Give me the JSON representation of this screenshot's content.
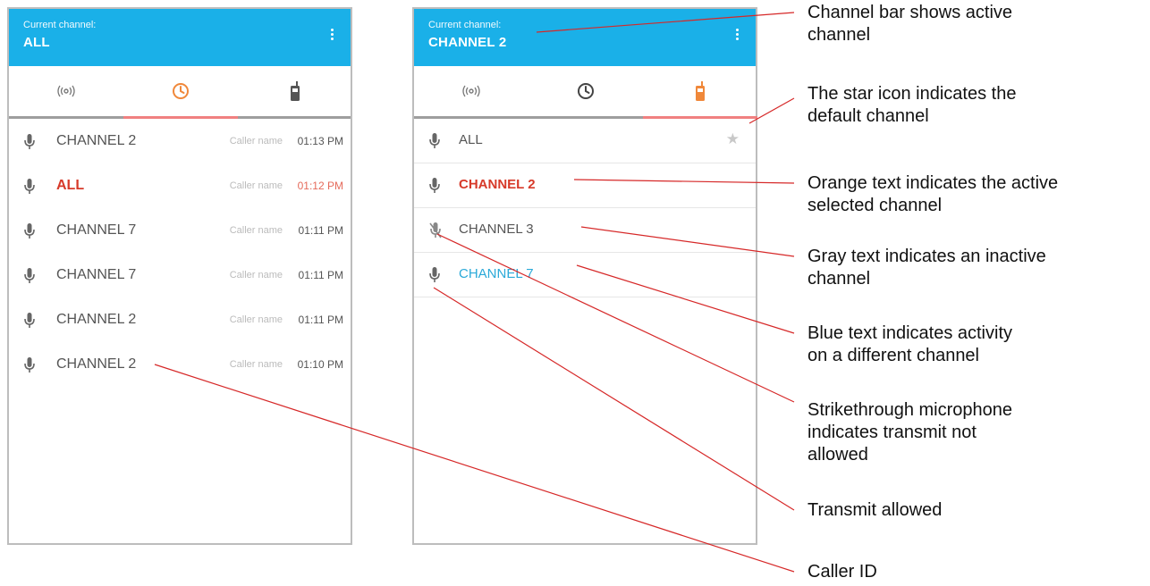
{
  "left_screen": {
    "header": {
      "caption": "Current channel:",
      "channel": "ALL"
    },
    "history": [
      {
        "channel": "CHANNEL 2",
        "caller": "Caller name",
        "time": "01:13 PM"
      },
      {
        "channel": "ALL",
        "caller": "Caller name",
        "time": "01:12 PM"
      },
      {
        "channel": "CHANNEL 7",
        "caller": "Caller name",
        "time": "01:11 PM"
      },
      {
        "channel": "CHANNEL 7",
        "caller": "Caller name",
        "time": "01:11 PM"
      },
      {
        "channel": "CHANNEL 2",
        "caller": "Caller name",
        "time": "01:11 PM"
      },
      {
        "channel": "CHANNEL 2",
        "caller": "Caller name",
        "time": "01:10 PM"
      }
    ]
  },
  "right_screen": {
    "header": {
      "caption": "Current channel:",
      "channel": "CHANNEL 2"
    },
    "channels": [
      {
        "name": "ALL",
        "star": "★"
      },
      {
        "name": "CHANNEL 2"
      },
      {
        "name": "CHANNEL 3"
      },
      {
        "name": "CHANNEL 7"
      }
    ]
  },
  "annotations": {
    "channel_bar": [
      "Channel bar shows active",
      "channel"
    ],
    "star": [
      "The star icon indicates the",
      "default channel"
    ],
    "orange": [
      "Orange text indicates the active",
      "selected channel"
    ],
    "gray": [
      "Gray text indicates an inactive",
      "channel"
    ],
    "blue": [
      "Blue text indicates activity",
      "on a different channel"
    ],
    "strike": [
      "Strikethrough microphone",
      "indicates transmit not",
      "allowed"
    ],
    "transmit": [
      "Transmit allowed"
    ],
    "caller_id": [
      "Caller ID"
    ]
  },
  "colors": {
    "appbar": "#1ab0e8",
    "active_text": "#d73a2a",
    "activity_text": "#2aa9d8",
    "tab_accent": "#f08080",
    "icon_orange": "#f0883a",
    "leader_line": "#d62828"
  }
}
